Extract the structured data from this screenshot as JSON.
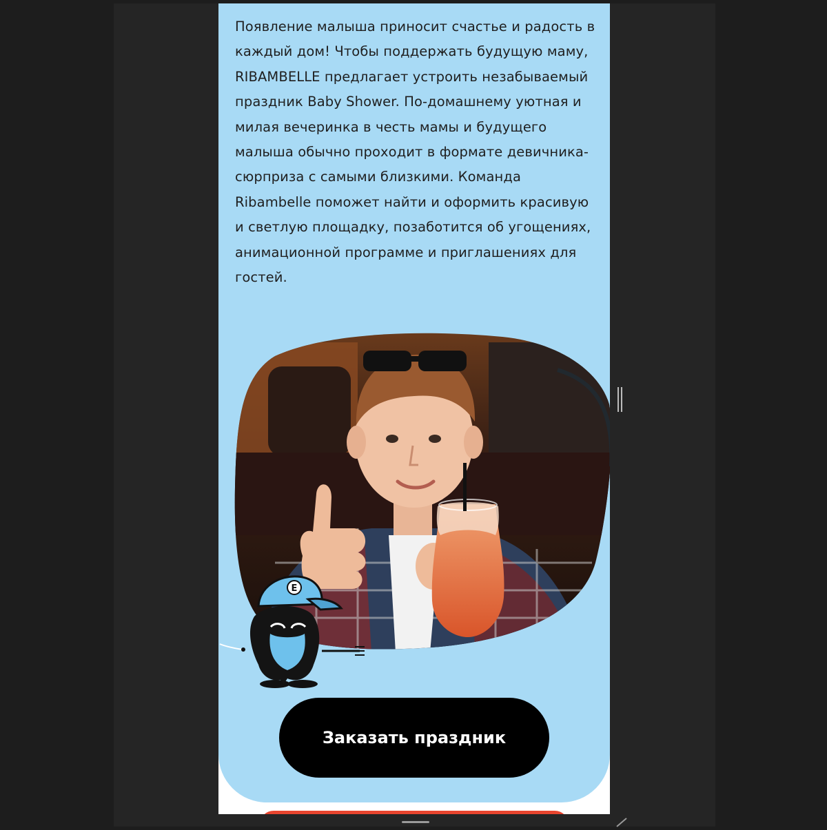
{
  "content": {
    "intro_text": "Появление малыша приносит счастье и радость в каждый дом! Чтобы поддержать будущую маму, RIBAMBELLE предлагает устроить незабываемый праздник Baby Shower. По-домашнему уютная и милая вечеринка в честь мамы и будущего малыша обычно проходит в формате девичника-сюрприза с самыми близкими. Команда Ribambelle поможет найти и оформить красивую и светлую площадку, позаботится об угощениях, анимационной программе и приглашениях для гостей."
  },
  "cta": {
    "order_label": "Заказать праздник"
  },
  "colors": {
    "card_background": "#a8daf5",
    "button_background": "#000000",
    "button_text": "#ffffff",
    "page_background": "#1d1d1d",
    "accent_next_section": "#e8452f"
  },
  "icons": {
    "mascot": "monster-mascot-icon",
    "scroll_handle": "scroll-handle-icon",
    "resize": "resize-grip-icon"
  }
}
